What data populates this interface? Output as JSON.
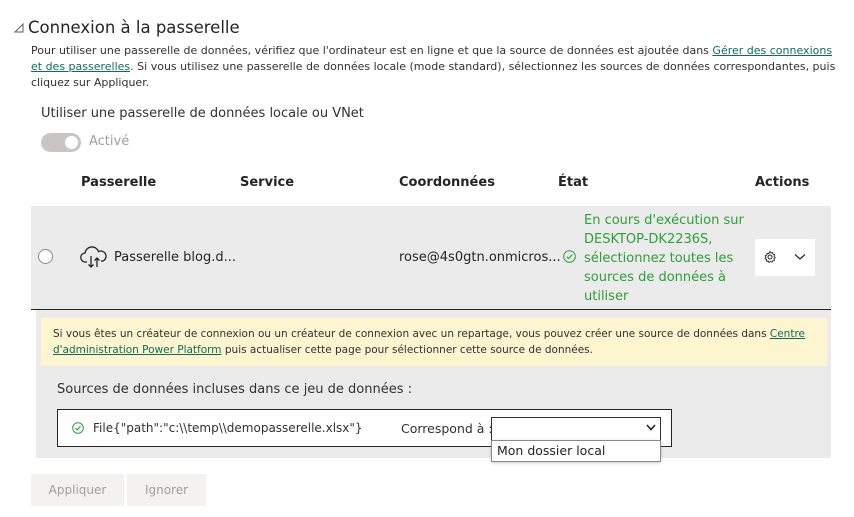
{
  "section": {
    "title": "Connexion à la passerelle",
    "description_prefix": "Pour utiliser une passerelle de données, vérifiez que l'ordinateur est en ligne et que la source de données est ajoutée dans ",
    "description_link": "Gérer des connexions et des passerelles",
    "description_suffix": ". Si vous utilisez une passerelle de données locale (mode standard), sélectionnez les sources de données correspondantes, puis cliquez sur Appliquer."
  },
  "toggle": {
    "label": "Utiliser une passerelle de données locale ou VNet",
    "state_label": "Activé",
    "on": true
  },
  "table": {
    "columns": [
      "Passerelle",
      "Service",
      "Coordonnées",
      "État",
      "Actions"
    ],
    "row": {
      "gateway": "Passerelle blog.d...",
      "service": "",
      "contact": "rose@4s0gtn.onmicros...",
      "status": "En cours d'exécution sur DESKTOP-DK2236S, sélectionnez toutes les sources de données à utiliser"
    }
  },
  "warning": {
    "prefix": "Si vous êtes un créateur de connexion ou un créateur de connexion avec un repartage, vous pouvez créer une source de données dans ",
    "link": "Centre d'administration Power Platform",
    "suffix": " puis actualiser cette page pour sélectionner cette source de données."
  },
  "datasources": {
    "label": "Sources de données incluses dans ce jeu de données :",
    "path": "File{\"path\":\"c:\\\\temp\\\\demopasserelle.xlsx\"}",
    "maps_to_label": "Correspond à :",
    "select_value": "",
    "options": [
      "Mon dossier local"
    ]
  },
  "buttons": {
    "apply": "Appliquer",
    "ignore": "Ignorer"
  },
  "colors": {
    "status_green": "#2f9e3a",
    "link": "#0f6c5a",
    "warning_bg": "#fdf4d0",
    "row_bg": "#ebebeb"
  }
}
